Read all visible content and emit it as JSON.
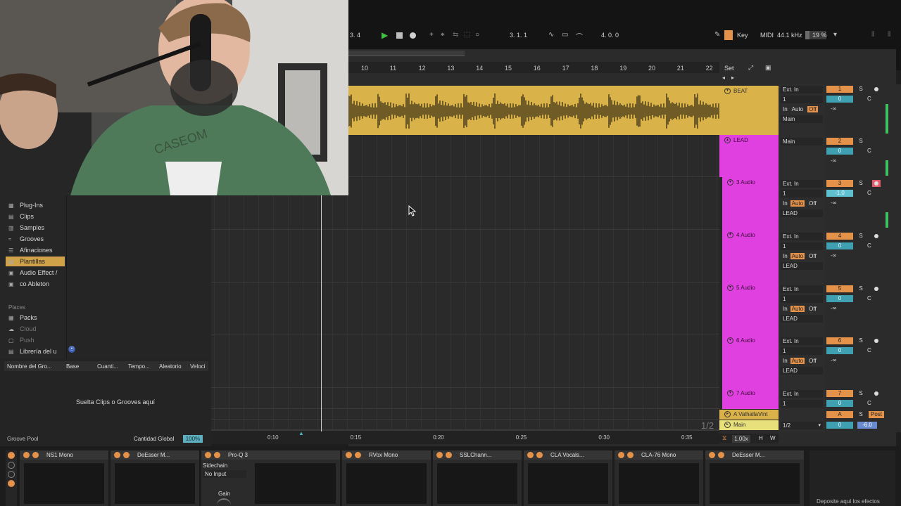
{
  "transport": {
    "position_left": "3.   4",
    "arrangement_position": "3.   1.   1",
    "loop_length": "4.   0.   0",
    "key_label": "Key",
    "midi_label": "MIDI",
    "sample_rate": "44.1 kHz",
    "cpu_load": "19 %",
    "cpu_load_fraction": 0.19
  },
  "arrangement": {
    "bar_numbers": [
      "10",
      "11",
      "12",
      "13",
      "14",
      "15",
      "16",
      "17",
      "18",
      "19",
      "20",
      "21",
      "22"
    ],
    "set_label": "Set",
    "page_indicator": "1/2",
    "time_labels": [
      "0:10",
      "0:15",
      "0:20",
      "0:25",
      "0:30",
      "0:35"
    ],
    "zoom_value": "1.00x",
    "h_label": "H",
    "w_label": "W"
  },
  "tracks": [
    {
      "name": "BEAT",
      "color": "#d9b24a",
      "input": "Ext. In",
      "channel": "1",
      "monitor": [
        "In",
        "Auto",
        "Off"
      ],
      "monitor_active": "Off",
      "output": "Main",
      "number": "1",
      "volume": "0",
      "pan": "C",
      "inf": "-∞"
    },
    {
      "name": "LEAD",
      "color": "#e040e0",
      "output": "Main",
      "number": "2",
      "volume": "0",
      "pan": "C",
      "inf": "-∞"
    },
    {
      "name": "3 Audio",
      "color": "#e040e0",
      "input": "Ext. In",
      "channel": "1",
      "monitor": [
        "In",
        "Auto",
        "Off"
      ],
      "monitor_active": "Auto",
      "output": "LEAD",
      "number": "3",
      "volume": "-1.0",
      "pan": "C",
      "inf": "-∞",
      "armed": true
    },
    {
      "name": "4 Audio",
      "color": "#e040e0",
      "input": "Ext. In",
      "channel": "1",
      "monitor": [
        "In",
        "Auto",
        "Off"
      ],
      "monitor_active": "Auto",
      "output": "LEAD",
      "number": "4",
      "volume": "0",
      "pan": "C",
      "inf": "-∞"
    },
    {
      "name": "5 Audio",
      "color": "#e040e0",
      "input": "Ext. In",
      "channel": "1",
      "monitor": [
        "In",
        "Auto",
        "Off"
      ],
      "monitor_active": "Auto",
      "output": "LEAD",
      "number": "5",
      "volume": "0",
      "pan": "C",
      "inf": "-∞"
    },
    {
      "name": "6 Audio",
      "color": "#e040e0",
      "input": "Ext. In",
      "channel": "1",
      "monitor": [
        "In",
        "Auto",
        "Off"
      ],
      "monitor_active": "Auto",
      "output": "LEAD",
      "number": "6",
      "volume": "0",
      "pan": "C",
      "inf": "-∞"
    },
    {
      "name": "7 Audio",
      "color": "#e040e0",
      "input": "Ext. In",
      "channel": "1",
      "number": "7",
      "volume": "0",
      "pan": "C"
    }
  ],
  "return_track": {
    "name": "A ValhallaVint",
    "number": "A",
    "solo": "S",
    "post": "Post"
  },
  "main_track": {
    "name": "Main",
    "channel": "1/2",
    "volume": "0",
    "gain": "-6.0"
  },
  "browser": {
    "items": [
      {
        "label": "Plug-Ins",
        "icon": "plugin-icon"
      },
      {
        "label": "Clips",
        "icon": "clip-icon"
      },
      {
        "label": "Samples",
        "icon": "sample-icon"
      },
      {
        "label": "Grooves",
        "icon": "groove-icon"
      },
      {
        "label": "Afinaciones",
        "icon": "tuning-icon"
      },
      {
        "label": "Plantillas",
        "icon": "template-icon",
        "selected": true
      },
      {
        "label": "Audio Effect /",
        "icon": "folder-icon"
      },
      {
        "label": "co Ableton",
        "icon": "folder-icon"
      }
    ],
    "places_header": "Places",
    "places": [
      {
        "label": "Packs",
        "icon": "packs-icon",
        "dim": false
      },
      {
        "label": "Cloud",
        "icon": "cloud-icon",
        "dim": true
      },
      {
        "label": "Push",
        "icon": "push-icon",
        "dim": true
      },
      {
        "label": "Librería del u",
        "icon": "library-icon",
        "dim": false
      }
    ]
  },
  "groove_pool": {
    "columns": [
      "Nombre del Gro...",
      "Base",
      "Cuanti...",
      "Tempo...",
      "Aleatorio",
      "Veloci"
    ],
    "empty_text": "Suelta Clips o Grooves aquí",
    "title": "Groove Pool",
    "global_label": "Cantidad Global",
    "global_value": "100%"
  },
  "devices": [
    {
      "name": "NS1 Mono"
    },
    {
      "name": "DeEsser M..."
    },
    {
      "name": "Pro-Q 3",
      "sidechain_label": "Sidechain",
      "sidechain_value": "No Input",
      "gain_label": "Gain"
    },
    {
      "name": "RVox Mono"
    },
    {
      "name": "SSLChann..."
    },
    {
      "name": "CLA Vocals..."
    },
    {
      "name": "CLA-76 Mono"
    },
    {
      "name": "DeEsser M..."
    }
  ],
  "drop_effects_text": "Deposite aquí los efectos",
  "colors": {
    "accent": "#e4924a",
    "beat": "#d9b24a",
    "lead": "#e040e0",
    "volume": "#3ea0b0",
    "selected": "#cfa24a"
  }
}
